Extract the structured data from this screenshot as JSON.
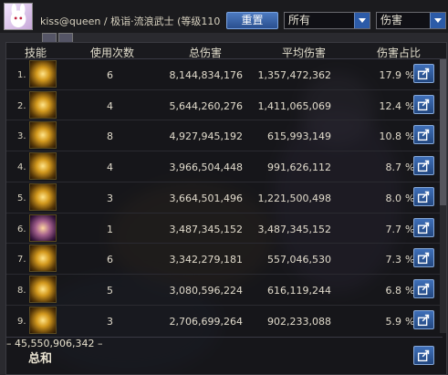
{
  "player": {
    "name": "kiss@queen",
    "separator": "/",
    "class_info": "极诣·流浪武士 (等级110"
  },
  "controls": {
    "reset_label": "重置",
    "filter_value": "所有",
    "metric_value": "伤害"
  },
  "table": {
    "headers": {
      "skill": "技能",
      "uses": "使用次数",
      "total": "总伤害",
      "avg": "平均伤害",
      "pct": "伤害占比"
    },
    "rows": [
      {
        "index": "1.",
        "uses": "6",
        "total": "8,144,834,176",
        "avg": "1,357,472,362",
        "pct": "17.9",
        "pct_unit": "%"
      },
      {
        "index": "2.",
        "uses": "4",
        "total": "5,644,260,276",
        "avg": "1,411,065,069",
        "pct": "12.4",
        "pct_unit": "%"
      },
      {
        "index": "3.",
        "uses": "8",
        "total": "4,927,945,192",
        "avg": "615,993,149",
        "pct": "10.8",
        "pct_unit": "%"
      },
      {
        "index": "4.",
        "uses": "4",
        "total": "3,966,504,448",
        "avg": "991,626,112",
        "pct": "8.7",
        "pct_unit": "%"
      },
      {
        "index": "5.",
        "uses": "3",
        "total": "3,664,501,496",
        "avg": "1,221,500,498",
        "pct": "8.0",
        "pct_unit": "%"
      },
      {
        "index": "6.",
        "uses": "1",
        "total": "3,487,345,152",
        "avg": "3,487,345,152",
        "pct": "7.7",
        "pct_unit": "%"
      },
      {
        "index": "7.",
        "uses": "6",
        "total": "3,342,279,181",
        "avg": "557,046,530",
        "pct": "7.3",
        "pct_unit": "%"
      },
      {
        "index": "8.",
        "uses": "5",
        "total": "3,080,596,224",
        "avg": "616,119,244",
        "pct": "6.8",
        "pct_unit": "%"
      },
      {
        "index": "9.",
        "uses": "3",
        "total": "2,706,699,264",
        "avg": "902,233,088",
        "pct": "5.9",
        "pct_unit": "%"
      }
    ],
    "total": {
      "label": "总和",
      "uses": "–",
      "total": "45,550,906,342",
      "avg": "–"
    }
  },
  "colors": {
    "share_button": "#2c5ba8",
    "accent_gold": "#d49a1e"
  },
  "icons": {
    "share": "share-export-icon",
    "dropdown": "chevron-down-icon"
  }
}
